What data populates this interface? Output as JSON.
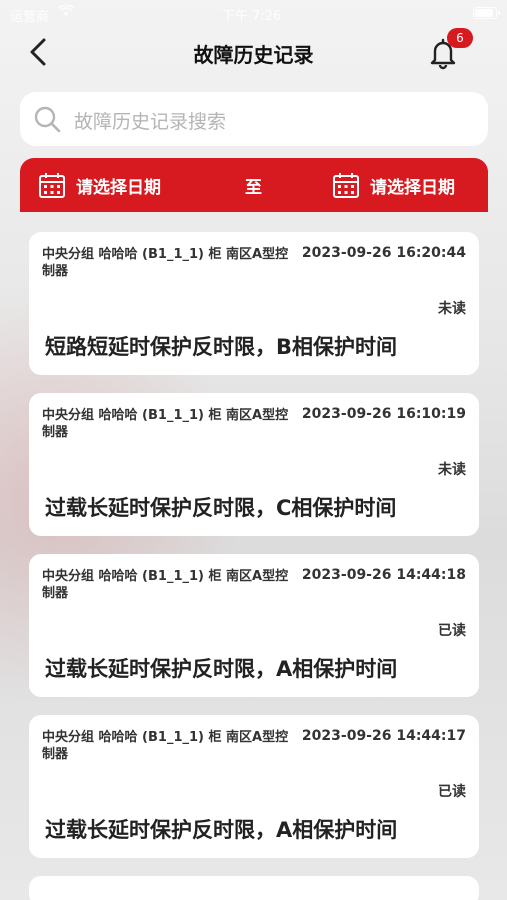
{
  "status_bar": {
    "carrier": "运营商",
    "wifi": "wifi-icon",
    "time": "下午 7:26",
    "battery": "battery-icon"
  },
  "nav": {
    "back_icon": "chevron-left-icon",
    "title": "故障历史记录",
    "bell_icon": "bell-icon",
    "badge_count": "6"
  },
  "search": {
    "icon": "search-icon",
    "placeholder": "故障历史记录搜索",
    "value": ""
  },
  "date_filter": {
    "start_label": "请选择日期",
    "separator": "至",
    "end_label": "请选择日期",
    "icon": "calendar-icon"
  },
  "colors": {
    "accent": "#d71920",
    "card_bg": "#ffffff",
    "placeholder": "#b5b5b5"
  },
  "records": [
    {
      "source": "中央分组 哈哈哈 (B1_1_1) 柜 南区A型控制器",
      "time": "2023-09-26 16:20:44",
      "status": "未读",
      "message": "短路短延时保护反时限，B相保护时间"
    },
    {
      "source": "中央分组 哈哈哈 (B1_1_1) 柜 南区A型控制器",
      "time": "2023-09-26 16:10:19",
      "status": "未读",
      "message": "过载长延时保护反时限，C相保护时间"
    },
    {
      "source": "中央分组 哈哈哈 (B1_1_1) 柜 南区A型控制器",
      "time": "2023-09-26 14:44:18",
      "status": "已读",
      "message": "过载长延时保护反时限，A相保护时间"
    },
    {
      "source": "中央分组 哈哈哈 (B1_1_1) 柜 南区A型控制器",
      "time": "2023-09-26 14:44:17",
      "status": "已读",
      "message": "过载长延时保护反时限，A相保护时间"
    }
  ]
}
